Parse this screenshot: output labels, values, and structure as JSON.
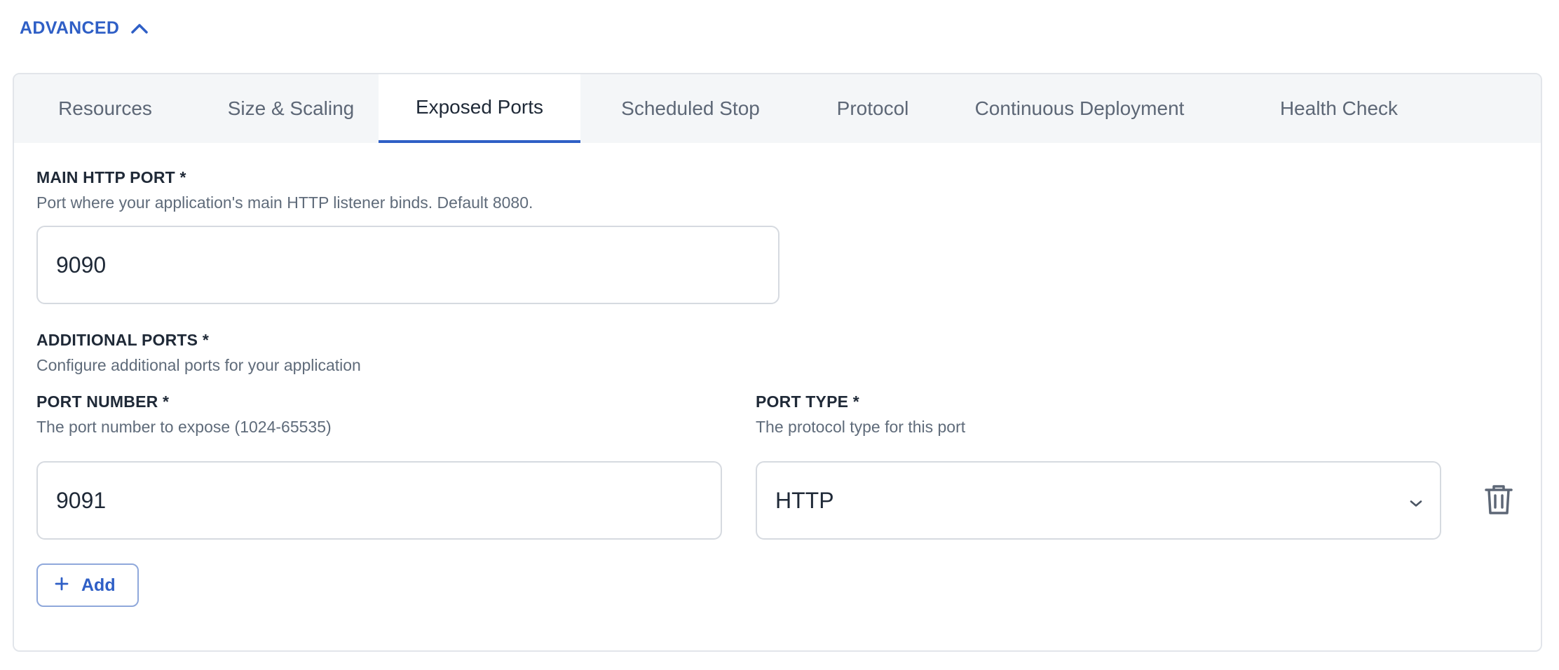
{
  "advanced": {
    "label": "ADVANCED",
    "expanded": true
  },
  "tabs": [
    {
      "label": "Resources"
    },
    {
      "label": "Size & Scaling"
    },
    {
      "label": "Exposed Ports",
      "active": true
    },
    {
      "label": "Scheduled Stop"
    },
    {
      "label": "Protocol"
    },
    {
      "label": "Continuous Deployment"
    },
    {
      "label": "Health Check"
    }
  ],
  "main_port": {
    "label": "MAIN HTTP PORT *",
    "description": "Port where your application's main HTTP listener binds. Default 8080.",
    "value": "9090"
  },
  "additional_ports": {
    "label": "ADDITIONAL PORTS *",
    "description": "Configure additional ports for your application",
    "port_number": {
      "label": "PORT NUMBER *",
      "description": "The port number to expose (1024-65535)",
      "value": "9091"
    },
    "port_type": {
      "label": "PORT TYPE *",
      "description": "The protocol type for this port",
      "value": "HTTP"
    },
    "add_label": "Add"
  },
  "colors": {
    "accent": "#2f5fc6",
    "border": "#d6dae0",
    "tabbar": "#f4f6f8"
  },
  "icons": {
    "collapse": "chevron-up-icon",
    "dropdown": "chevron-down-icon",
    "delete": "trash-icon",
    "add": "plus-icon"
  }
}
